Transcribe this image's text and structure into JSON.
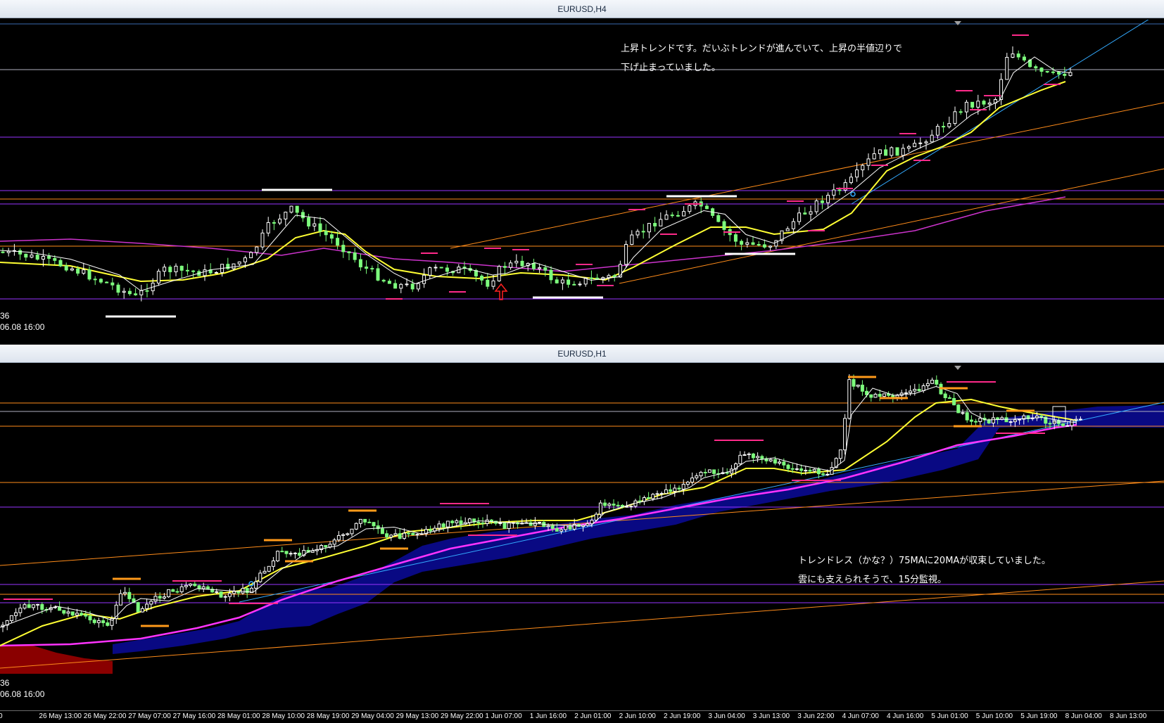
{
  "top_chart": {
    "title": "EURUSD,H4",
    "note_line1": "上昇トレンドです。だいぶトレンドが進んでいて、上昇の半値辺りで",
    "note_line2": "下げ止まっていました。",
    "price_label": "36",
    "date_label": "06.08 16:00"
  },
  "bottom_chart": {
    "title": "EURUSD,H1",
    "note_line1": "トレンドレス（かな？）75MAに20MAが収束していました。",
    "note_line2": "雲にも支えられそうで、15分監視。",
    "price_label": "36",
    "date_label": "06.08 16:00"
  },
  "time_axis": [
    "0",
    "26 May 13:00",
    "26 May 22:00",
    "27 May 07:00",
    "27 May 16:00",
    "28 May 01:00",
    "28 May 10:00",
    "28 May 19:00",
    "29 May 04:00",
    "29 May 13:00",
    "29 May 22:00",
    "1 Jun 07:00",
    "1 Jun 16:00",
    "2 Jun 01:00",
    "2 Jun 10:00",
    "2 Jun 19:00",
    "3 Jun 04:00",
    "3 Jun 13:00",
    "3 Jun 22:00",
    "4 Jun 07:00",
    "4 Jun 16:00",
    "5 Jun 01:00",
    "5 Jun 10:00",
    "5 Jun 19:00",
    "8 Jun 04:00",
    "8 Jun 13:00"
  ],
  "colors": {
    "background": "#000000",
    "bull_candle": "#ffffff",
    "bear_candle": "#7dff7d",
    "ma_fast": "#ffffff",
    "ma_20": "#ffff33",
    "ma_75": "#ff33ff",
    "h4_long_ma": "#cc33cc",
    "cloud_up": "#0a0a8a",
    "cloud_down": "#8a0000",
    "trendline_orange": "#ff8c1a",
    "trendline_blue": "#33aaff",
    "level_purple": "#9933ff",
    "level_orange": "#ff8c1a",
    "level_gray": "#b0b0c0"
  }
}
